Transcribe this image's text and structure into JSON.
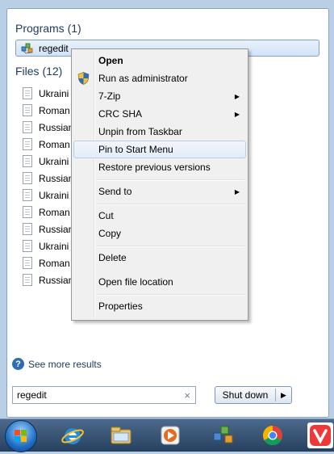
{
  "start_menu": {
    "programs_header": "Programs (1)",
    "program_item": "regedit",
    "files_header": "Files (12)",
    "files": [
      "Ukraini",
      "Roman",
      "Russian",
      "Roman",
      "Ukraini",
      "Russian",
      "Ukraini",
      "Roman",
      "Russian",
      "Ukraini",
      "Roman",
      "Russian"
    ],
    "see_more": "See more results",
    "search_value": "regedit",
    "search_clear": "×",
    "shutdown_label": "Shut down",
    "shutdown_arrow": "▶"
  },
  "context_menu": {
    "items": [
      {
        "label": "Open"
      },
      {
        "label": "Run as administrator"
      },
      {
        "label": "7-Zip"
      },
      {
        "label": "CRC SHA"
      },
      {
        "label": "Unpin from Taskbar"
      },
      {
        "label": "Pin to Start Menu"
      },
      {
        "label": "Restore previous versions"
      },
      {
        "label": "Send to"
      },
      {
        "label": "Cut"
      },
      {
        "label": "Copy"
      },
      {
        "label": "Delete"
      },
      {
        "label": "Open file location"
      },
      {
        "label": "Properties"
      }
    ],
    "submenu_arrow": "▶"
  },
  "taskbar": {
    "icons": [
      "windows-orb-icon",
      "internet-explorer-icon",
      "file-explorer-icon",
      "media-player-icon",
      "regedit-icon",
      "chrome-icon",
      "vivaldi-icon"
    ]
  },
  "colors": {
    "accent": "#1e395b",
    "menu_highlight": "#e3ecf7"
  }
}
